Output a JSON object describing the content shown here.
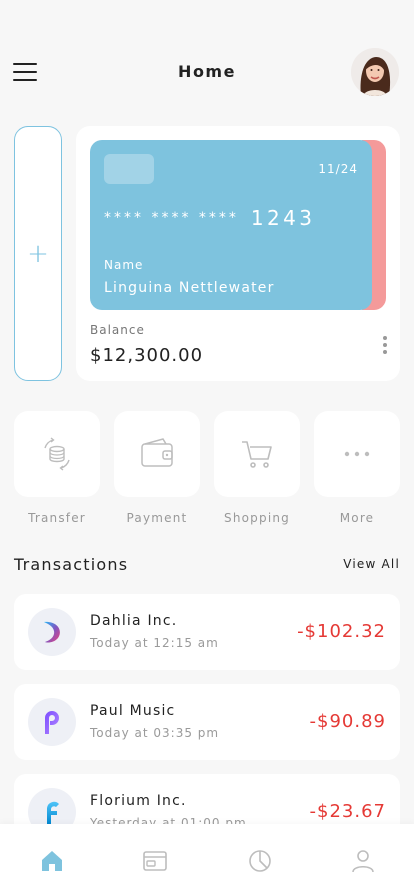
{
  "header": {
    "title": "Home"
  },
  "card": {
    "expiry": "11/24",
    "number_masked": "**** **** ****",
    "number_last": "1243",
    "name_label": "Name",
    "name_value": "Linguina Nettlewater",
    "balance_label": "Balance",
    "balance_value": "$12,300.00",
    "colors": {
      "front": "#7ec3de",
      "back": "#f49a9a"
    }
  },
  "actions": [
    {
      "label": "Transfer",
      "icon": "transfer-icon"
    },
    {
      "label": "Payment",
      "icon": "wallet-icon"
    },
    {
      "label": "Shopping",
      "icon": "cart-icon"
    },
    {
      "label": "More",
      "icon": "more-icon"
    }
  ],
  "transactions": {
    "title": "Transactions",
    "view_all": "View All",
    "items": [
      {
        "name": "Dahlia Inc.",
        "time": "Today at 12:15 am",
        "amount": "-$102.32",
        "icon": "dahlia-logo"
      },
      {
        "name": "Paul Music",
        "time": "Today at 03:35 pm",
        "amount": "-$90.89",
        "icon": "paul-music-logo"
      },
      {
        "name": "Florium Inc.",
        "time": "Yesterday at 01:00 pm",
        "amount": "-$23.67",
        "icon": "florium-logo"
      }
    ]
  },
  "bottom_nav": [
    {
      "icon": "home-icon",
      "active": true
    },
    {
      "icon": "wallet-card-icon",
      "active": false
    },
    {
      "icon": "pie-chart-icon",
      "active": false
    },
    {
      "icon": "profile-icon",
      "active": false
    }
  ],
  "colors": {
    "accent": "#7ec3de",
    "negative": "#e53935",
    "muted": "#999999"
  }
}
